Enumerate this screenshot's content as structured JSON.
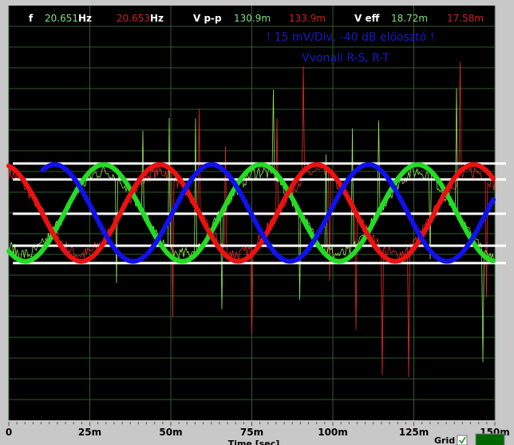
{
  "chart_data": {
    "type": "line",
    "xlabel": "Time [sec]",
    "ylabel": "",
    "xlim": [
      0,
      0.15
    ],
    "ylim_mV": [
      -150,
      150
    ],
    "x_ticks": [
      "0",
      "25m",
      "50m",
      "75m",
      "100m",
      "125m",
      "150m"
    ],
    "x_tick_values": [
      0,
      0.025,
      0.05,
      0.075,
      0.1,
      0.125,
      0.15
    ],
    "grid": true,
    "background": "#000000",
    "grid_color": "#2f5a2f",
    "measurements": {
      "f_label": "f",
      "f_green": "20.651",
      "f_red": "20.653",
      "hz_unit": "Hz",
      "vpp_label": "V p-p",
      "vpp_green": "130.9m",
      "vpp_red": "133.9m",
      "veff_label": "V eff",
      "veff_green": "18.72m",
      "veff_red": "17.58m"
    },
    "annotations": [
      "! 15 mV/Div, -40 dB előosztó !",
      "Vvonali R-S, R-T"
    ],
    "series": [
      {
        "color": "#22dd22",
        "kind": "sine",
        "frequency_hz": 20.65,
        "amplitude_mV": 35,
        "peak_time_s": 0.0293
      },
      {
        "color": "#ee1111",
        "kind": "sine",
        "frequency_hz": 20.65,
        "amplitude_mV": 35,
        "peak_time_s": 0.0466
      },
      {
        "color": "#1111ee",
        "kind": "sine",
        "frequency_hz": 20.65,
        "amplitude_mV": 35,
        "peak_time_s": 0.0626
      },
      {
        "color": "#ff3030",
        "kind": "raw-noisy",
        "frequency_hz": 20.653
      },
      {
        "color": "#aaff66",
        "kind": "raw-noisy",
        "frequency_hz": 20.651
      }
    ],
    "reference_lines_mV": [
      35.8,
      24.2,
      -0.6,
      -23.7,
      -36.3
    ],
    "reference_line_color": "#ffffff"
  },
  "controls": {
    "grid_label": "Grid",
    "grid_checked": true,
    "grid_color_swatch": "#006600"
  }
}
